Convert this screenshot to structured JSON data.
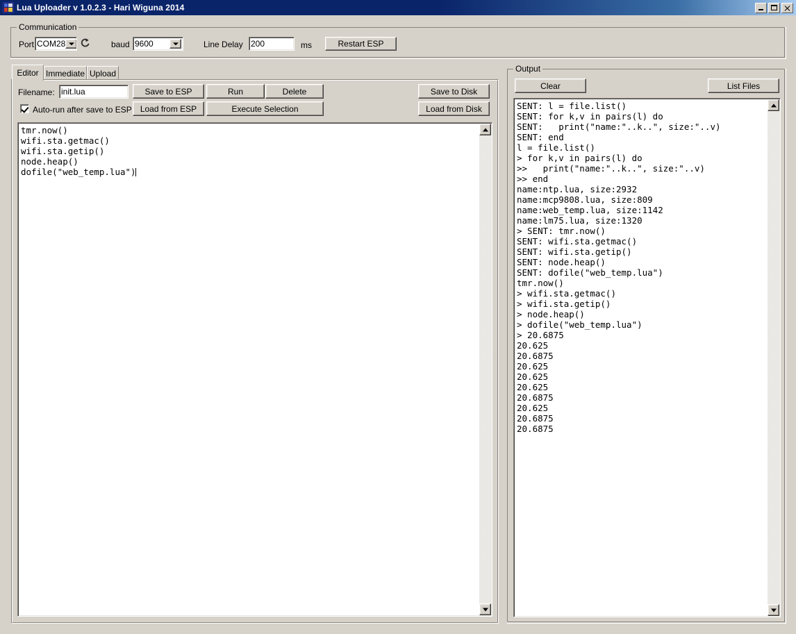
{
  "window": {
    "title": "Lua Uploader v 1.0.2.3 - Hari Wiguna 2014",
    "icon": "app-window-icon",
    "buttons": {
      "minimize": "_",
      "maximize": "□",
      "close": "✕"
    }
  },
  "communication": {
    "group_label": "Communication",
    "port_label": "Port",
    "port_value": "COM28",
    "refresh_icon": "refresh-icon",
    "baud_label": "baud",
    "baud_value": "9600",
    "line_delay_label": "Line Delay",
    "line_delay_value": "200",
    "ms_label": "ms",
    "restart_button": "Restart ESP"
  },
  "tabs": [
    {
      "label": "Editor",
      "active": true
    },
    {
      "label": "Immediate",
      "active": false
    },
    {
      "label": "Upload",
      "active": false
    }
  ],
  "editor_panel": {
    "filename_label": "Filename:",
    "filename_value": "init.lua",
    "autorun_label": "Auto-run after save to ESP",
    "autorun_checked": true,
    "buttons": {
      "save_to_esp": "Save to ESP",
      "run": "Run",
      "delete": "Delete",
      "load_from_esp": "Load from ESP",
      "execute_selection": "Execute Selection",
      "save_to_disk": "Save to Disk",
      "load_from_disk": "Load from Disk"
    },
    "code": "tmr.now()\nwifi.sta.getmac()\nwifi.sta.getip()\nnode.heap()\ndofile(\"web_temp.lua\")"
  },
  "output_panel": {
    "group_label": "Output",
    "clear_button": "Clear",
    "list_files_button": "List Files",
    "log": "SENT: l = file.list()\nSENT: for k,v in pairs(l) do\nSENT:   print(\"name:\"..k..\", size:\"..v)\nSENT: end\nl = file.list()\n> for k,v in pairs(l) do\n>>   print(\"name:\"..k..\", size:\"..v)\n>> end\nname:ntp.lua, size:2932\nname:mcp9808.lua, size:809\nname:web_temp.lua, size:1142\nname:lm75.lua, size:1320\n> SENT: tmr.now()\nSENT: wifi.sta.getmac()\nSENT: wifi.sta.getip()\nSENT: node.heap()\nSENT: dofile(\"web_temp.lua\")\ntmr.now()\n> wifi.sta.getmac()\n> wifi.sta.getip()\n> node.heap()\n> dofile(\"web_temp.lua\")\n> 20.6875\n20.625\n20.6875\n20.625\n20.625\n20.625\n20.6875\n20.625\n20.6875\n20.6875"
  },
  "colors": {
    "face": "#d6d2ca",
    "titlebar_start": "#0a246a",
    "titlebar_end": "#a6caf0",
    "shadow": "#87837b",
    "text": "#000000"
  }
}
